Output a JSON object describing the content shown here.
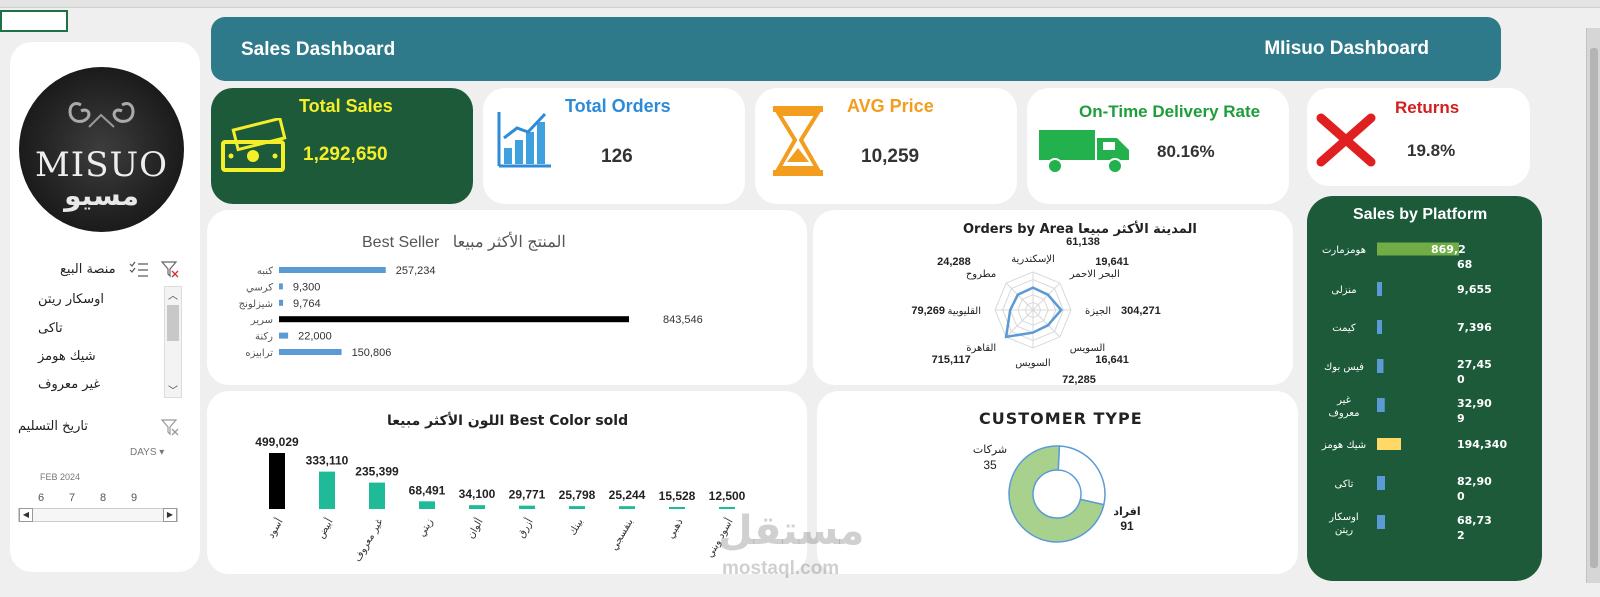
{
  "header": {
    "left_title": "Sales Dashboard",
    "right_title": "MIisuo Dashboard"
  },
  "logo": {
    "text_en": "MISUO",
    "text_ar": "مسيو"
  },
  "kpis": [
    {
      "title": "Total Sales",
      "value": "1,292,650"
    },
    {
      "title": "Total Orders",
      "value": "126"
    },
    {
      "title": "AVG  Price",
      "value": "10,259"
    },
    {
      "title": "On-Time Delivery Rate",
      "value": "80.16%"
    },
    {
      "title": "Returns",
      "value": "19.8%"
    }
  ],
  "slicer_platform": {
    "title": "منصة البيع",
    "items": [
      "اوسكار ريتن",
      "تاكى",
      "شيك هومز",
      "غير معروف"
    ]
  },
  "slicer_date": {
    "title": "تاريخ التسليم",
    "unit": "DAYS",
    "month": "FEB 2024",
    "days": [
      "6",
      "7",
      "8",
      "9"
    ]
  },
  "best_seller": {
    "title_ar": "المنتج الأكثر مبيعا",
    "title_en": "Best  Seller"
  },
  "orders_by_area": {
    "title": "Orders by Area المدينة الأكثر مبيعا"
  },
  "best_color": {
    "title": "اللون الأكثر مبيعا  Best Color sold"
  },
  "customer_type": {
    "title": "CUSTOMER TYPE"
  },
  "sales_platform": {
    "title": "Sales by Platform"
  },
  "watermark": {
    "ar": "مستقل",
    "en": "mostaql.com"
  },
  "chart_data": [
    {
      "type": "bar",
      "orientation": "horizontal",
      "categories": [
        "كنبه",
        "كرسي",
        "شيزلونج",
        "سرير",
        "ركنة",
        "ترابيزه"
      ],
      "values": [
        257234,
        9300,
        9764,
        843546,
        22000,
        150806
      ],
      "labels": [
        "257,234",
        "9,300",
        "9,764",
        "843,546",
        "22,000",
        "150,806"
      ],
      "highlight_index": 3,
      "colors": {
        "normal": "#5b9bd5",
        "highlight": "#000000"
      }
    },
    {
      "type": "radar",
      "categories": [
        "الإسكندرية",
        "البحر الاحمر",
        "الجيزة",
        "السويس",
        "السويس",
        "القاهرة",
        "القليوبية",
        "مطروح"
      ],
      "values": [
        61138,
        19641,
        304271,
        16641,
        72285,
        715117,
        79269,
        24288
      ],
      "labels": [
        "61,138",
        "19,641",
        "304,271",
        "16,641",
        "72,285",
        "715,117",
        "79,269",
        "24,288"
      ],
      "color": "#5b9bd5"
    },
    {
      "type": "bar",
      "categories": [
        "أسود",
        "أبيض",
        "غير معروف",
        "زيتي",
        "ألوان",
        "أزرق",
        "بينك",
        "بنفسجي",
        "ذهبي",
        "أسود وبني"
      ],
      "values": [
        499029,
        333110,
        235399,
        68491,
        34100,
        29771,
        25798,
        25244,
        15528,
        12500
      ],
      "labels": [
        "499,029",
        "333,110",
        "235,399",
        "68,491",
        "34,100",
        "29,771",
        "25,798",
        "25,244",
        "15,528",
        "12,500"
      ],
      "colors": {
        "first": "#000000",
        "rest": "#1fba98"
      }
    },
    {
      "type": "pie",
      "donut": true,
      "categories": [
        "شركات",
        "افراد"
      ],
      "values": [
        35,
        91
      ],
      "labels": [
        "35",
        "91"
      ],
      "colors": [
        "#ffffff",
        "#a9d18e"
      ]
    },
    {
      "type": "bar",
      "orientation": "horizontal",
      "categories": [
        "هومزمارت",
        "منزلى",
        "كيمت",
        "فيس بوك",
        "غير معروف",
        "شيك هومز",
        "تاكى",
        "اوسكار ريتن"
      ],
      "values": [
        869268,
        9655,
        7396,
        27450,
        32909,
        194340,
        82900,
        68732
      ],
      "labels": [
        "869,2\n68",
        "9,655",
        "7,396",
        "27,45\n0",
        "32,90\n9",
        "194,340",
        "82,90\n0",
        "68,73\n2"
      ],
      "colors": [
        "#70ad47",
        "#5b9bd5",
        "#5b9bd5",
        "#5b9bd5",
        "#5b9bd5",
        "#ffd966",
        "#5b9bd5",
        "#5b9bd5"
      ]
    }
  ]
}
